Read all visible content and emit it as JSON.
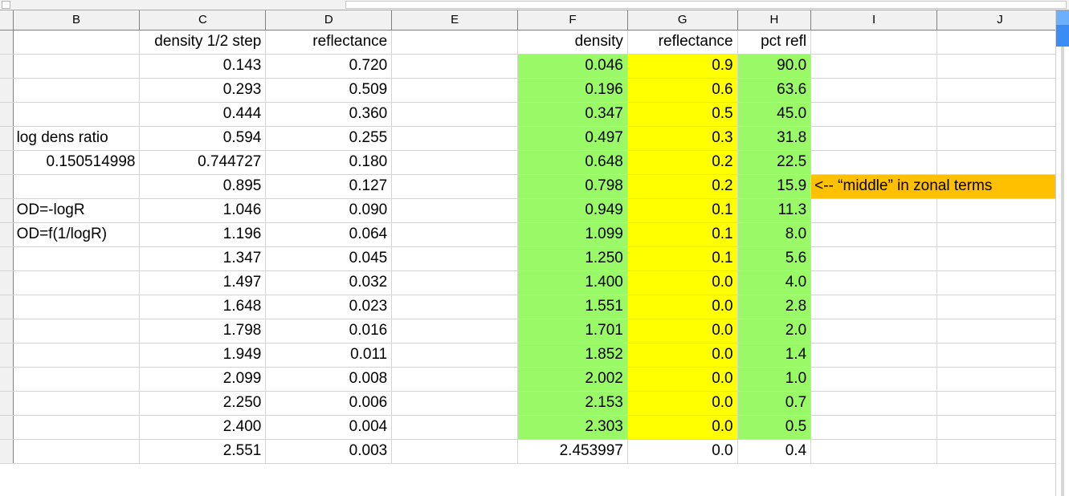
{
  "app": {
    "kind": "spreadsheet",
    "name_box_value": "",
    "formula_bar_value": ""
  },
  "colors": {
    "fill_green": "#99f966",
    "fill_yellow": "#ffff00",
    "fill_orange": "#ffc000",
    "header_bg": "#f1f1f1",
    "grid_line": "#d4d4d4",
    "scrollbar_thumb": "#3b8cf5"
  },
  "columns": [
    {
      "id": "B",
      "label": "B"
    },
    {
      "id": "C",
      "label": "C"
    },
    {
      "id": "D",
      "label": "D"
    },
    {
      "id": "E",
      "label": "E"
    },
    {
      "id": "F",
      "label": "F"
    },
    {
      "id": "G",
      "label": "G"
    },
    {
      "id": "H",
      "label": "H"
    },
    {
      "id": "I",
      "label": "I"
    },
    {
      "id": "J",
      "label": "J"
    }
  ],
  "headers": {
    "C": "density 1/2 step",
    "D": "reflectance",
    "F": "density",
    "G": "reflectance",
    "H": "pct refl"
  },
  "labels": {
    "log_dens_ratio": "log dens ratio",
    "log_dens_ratio_value": "0.150514998",
    "od_neg_log_r": "OD=-logR",
    "od_f_inv_log_r": "OD=f(1/logR)"
  },
  "annotation": {
    "text": "<-- “middle” in zonal terms",
    "row_index": 6
  },
  "rows": [
    {
      "B": "",
      "C": "density 1/2 step",
      "D": "reflectance",
      "E": "",
      "F": "density",
      "G": "reflectance",
      "H": "pct refl",
      "I": "",
      "J": "",
      "fill": false,
      "header": true
    },
    {
      "B": "",
      "C": "0.143",
      "D": "0.720",
      "E": "",
      "F": "0.046",
      "G": "0.9",
      "H": "90.0",
      "I": "",
      "J": "",
      "fill": true
    },
    {
      "B": "",
      "C": "0.293",
      "D": "0.509",
      "E": "",
      "F": "0.196",
      "G": "0.6",
      "H": "63.6",
      "I": "",
      "J": "",
      "fill": true
    },
    {
      "B": "",
      "C": "0.444",
      "D": "0.360",
      "E": "",
      "F": "0.347",
      "G": "0.5",
      "H": "45.0",
      "I": "",
      "J": "",
      "fill": true
    },
    {
      "B": "log dens ratio",
      "C": "0.594",
      "D": "0.255",
      "E": "",
      "F": "0.497",
      "G": "0.3",
      "H": "31.8",
      "I": "",
      "J": "",
      "fill": true
    },
    {
      "B": "0.150514998",
      "C": "0.744727",
      "D": "0.180",
      "E": "",
      "F": "0.648",
      "G": "0.2",
      "H": "22.5",
      "I": "",
      "J": "",
      "fill": true
    },
    {
      "B": "",
      "C": "0.895",
      "D": "0.127",
      "E": "",
      "F": "0.798",
      "G": "0.2",
      "H": "15.9",
      "I": "<-- “middle” in zonal terms",
      "J": "",
      "fill": true,
      "annot": true
    },
    {
      "B": "OD=-logR",
      "C": "1.046",
      "D": "0.090",
      "E": "",
      "F": "0.949",
      "G": "0.1",
      "H": "11.3",
      "I": "",
      "J": "",
      "fill": true
    },
    {
      "B": "OD=f(1/logR)",
      "C": "1.196",
      "D": "0.064",
      "E": "",
      "F": "1.099",
      "G": "0.1",
      "H": "8.0",
      "I": "",
      "J": "",
      "fill": true
    },
    {
      "B": "",
      "C": "1.347",
      "D": "0.045",
      "E": "",
      "F": "1.250",
      "G": "0.1",
      "H": "5.6",
      "I": "",
      "J": "",
      "fill": true
    },
    {
      "B": "",
      "C": "1.497",
      "D": "0.032",
      "E": "",
      "F": "1.400",
      "G": "0.0",
      "H": "4.0",
      "I": "",
      "J": "",
      "fill": true
    },
    {
      "B": "",
      "C": "1.648",
      "D": "0.023",
      "E": "",
      "F": "1.551",
      "G": "0.0",
      "H": "2.8",
      "I": "",
      "J": "",
      "fill": true
    },
    {
      "B": "",
      "C": "1.798",
      "D": "0.016",
      "E": "",
      "F": "1.701",
      "G": "0.0",
      "H": "2.0",
      "I": "",
      "J": "",
      "fill": true
    },
    {
      "B": "",
      "C": "1.949",
      "D": "0.011",
      "E": "",
      "F": "1.852",
      "G": "0.0",
      "H": "1.4",
      "I": "",
      "J": "",
      "fill": true
    },
    {
      "B": "",
      "C": "2.099",
      "D": "0.008",
      "E": "",
      "F": "2.002",
      "G": "0.0",
      "H": "1.0",
      "I": "",
      "J": "",
      "fill": true
    },
    {
      "B": "",
      "C": "2.250",
      "D": "0.006",
      "E": "",
      "F": "2.153",
      "G": "0.0",
      "H": "0.7",
      "I": "",
      "J": "",
      "fill": true
    },
    {
      "B": "",
      "C": "2.400",
      "D": "0.004",
      "E": "",
      "F": "2.303",
      "G": "0.0",
      "H": "0.5",
      "I": "",
      "J": "",
      "fill": true
    },
    {
      "B": "",
      "C": "2.551",
      "D": "0.003",
      "E": "",
      "F": "2.453997",
      "G": "0.0",
      "H": "0.4",
      "I": "",
      "J": "",
      "fill": false,
      "partial": true
    }
  ]
}
